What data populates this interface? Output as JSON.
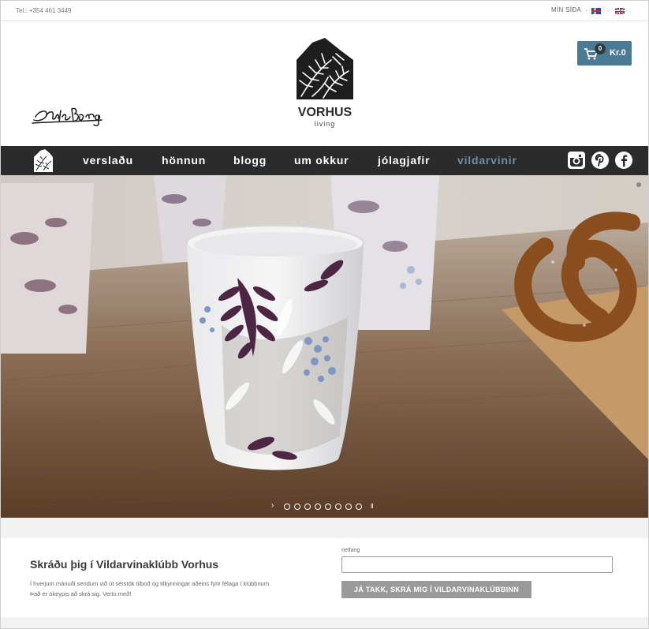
{
  "topbar": {
    "phone": "Tel.: +354 461 3449",
    "my_site": "MÍN SÍÐA",
    "separator": "·",
    "flags": [
      "iceland-flag-icon",
      "uk-flag-icon"
    ]
  },
  "header": {
    "brand_name": "VORHUS",
    "brand_sub": "living",
    "cart_count": "0",
    "cart_amount": "Kr.0"
  },
  "nav": {
    "items": [
      {
        "label": "verslaðu",
        "active": false
      },
      {
        "label": "hönnun",
        "active": false
      },
      {
        "label": "blogg",
        "active": false
      },
      {
        "label": "um okkur",
        "active": false
      },
      {
        "label": "jólagjafir",
        "active": false
      },
      {
        "label": "vildarvinir",
        "active": true
      }
    ],
    "social_icons": [
      "instagram-icon",
      "pinterest-icon",
      "facebook-icon"
    ]
  },
  "slider": {
    "slide_count": 8,
    "pause_symbol": "II",
    "next_symbol": "›"
  },
  "signup": {
    "title": "Skráðu þig í Vildarvinaklúbb Vorhus",
    "text_line1": "Í hverjum mánuði sendum við út sérstök tilboð og tilkynningar aðeins fyrir félaga í klúbbnum.",
    "text_line2": "Það er ókeypis að skrá sig.  Vertu með!",
    "email_label": "netfang",
    "email_value": "",
    "button_label": "JÁ TAKK, SKRÁ MIG Í VILDARVINAKLÚBBINN"
  },
  "colors": {
    "nav_bg": "#2b2b2b",
    "nav_active": "#6b8ea6",
    "cart_bg": "#4a7a94",
    "button_bg": "#9a9a9a"
  }
}
